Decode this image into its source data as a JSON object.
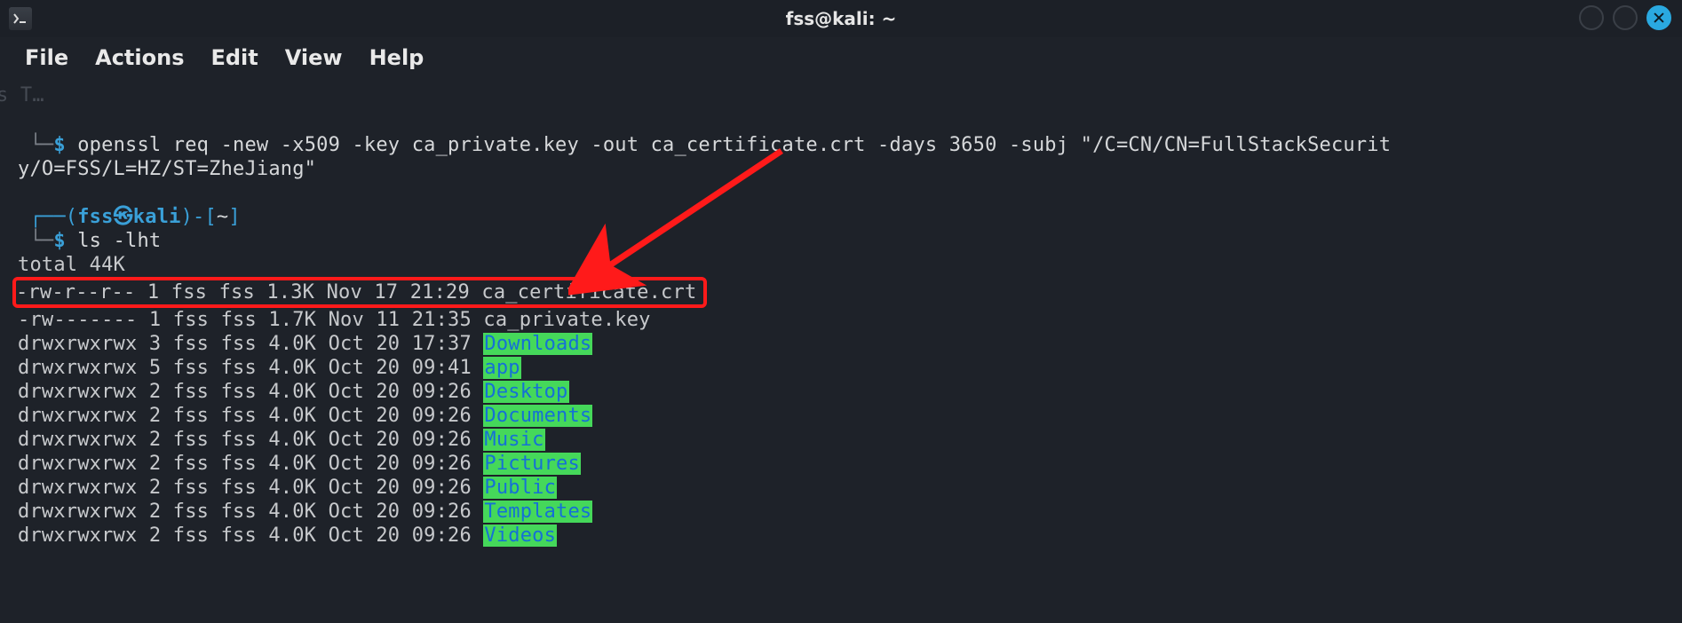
{
  "window": {
    "title": "fss@kali: ~",
    "app_icon": "␣"
  },
  "menu": {
    "items": [
      "File",
      "Actions",
      "Edit",
      "View",
      "Help"
    ]
  },
  "background_tab_hint": "s T…",
  "prompt1": {
    "corner": "└─",
    "dollar": "$",
    "command": "openssl req -new -x509 -key ca_private.key -out ca_certificate.crt -days 3650 -subj \"/C=CN/CN=FullStackSecurity/O=FSS/L=HZ/ST=ZheJiang\""
  },
  "prompt2": {
    "top": "┌──(",
    "user": "fss",
    "sep": "㉿",
    "host": "kali",
    "tail": ")-[",
    "path": "~",
    "close": "]",
    "corner": "└─",
    "dollar": "$",
    "command": "ls -lht"
  },
  "ls_output": {
    "total": "total 44K",
    "rows": [
      {
        "perm": "-rw-r--r--",
        "links": "1",
        "owner": "fss",
        "group": "fss",
        "size": "1.3K",
        "date": "Nov 17 21:29",
        "name": "ca_certificate.crt",
        "type": "file",
        "highlight": true
      },
      {
        "perm": "-rw-------",
        "links": "1",
        "owner": "fss",
        "group": "fss",
        "size": "1.7K",
        "date": "Nov 11 21:35",
        "name": "ca_private.key",
        "type": "file"
      },
      {
        "perm": "drwxrwxrwx",
        "links": "3",
        "owner": "fss",
        "group": "fss",
        "size": "4.0K",
        "date": "Oct 20 17:37",
        "name": "Downloads",
        "type": "dir"
      },
      {
        "perm": "drwxrwxrwx",
        "links": "5",
        "owner": "fss",
        "group": "fss",
        "size": "4.0K",
        "date": "Oct 20 09:41",
        "name": "app",
        "type": "dir"
      },
      {
        "perm": "drwxrwxrwx",
        "links": "2",
        "owner": "fss",
        "group": "fss",
        "size": "4.0K",
        "date": "Oct 20 09:26",
        "name": "Desktop",
        "type": "dir"
      },
      {
        "perm": "drwxrwxrwx",
        "links": "2",
        "owner": "fss",
        "group": "fss",
        "size": "4.0K",
        "date": "Oct 20 09:26",
        "name": "Documents",
        "type": "dir"
      },
      {
        "perm": "drwxrwxrwx",
        "links": "2",
        "owner": "fss",
        "group": "fss",
        "size": "4.0K",
        "date": "Oct 20 09:26",
        "name": "Music",
        "type": "dir"
      },
      {
        "perm": "drwxrwxrwx",
        "links": "2",
        "owner": "fss",
        "group": "fss",
        "size": "4.0K",
        "date": "Oct 20 09:26",
        "name": "Pictures",
        "type": "dir"
      },
      {
        "perm": "drwxrwxrwx",
        "links": "2",
        "owner": "fss",
        "group": "fss",
        "size": "4.0K",
        "date": "Oct 20 09:26",
        "name": "Public",
        "type": "dir"
      },
      {
        "perm": "drwxrwxrwx",
        "links": "2",
        "owner": "fss",
        "group": "fss",
        "size": "4.0K",
        "date": "Oct 20 09:26",
        "name": "Templates",
        "type": "dir"
      },
      {
        "perm": "drwxrwxrwx",
        "links": "2",
        "owner": "fss",
        "group": "fss",
        "size": "4.0K",
        "date": "Oct 20 09:26",
        "name": "Videos",
        "type": "dir"
      }
    ]
  },
  "colors": {
    "accent": "#3aa0d8",
    "highlight_border": "#ff1a1a",
    "dir_fg": "#1570d6",
    "dir_bg": "#45d85a"
  }
}
